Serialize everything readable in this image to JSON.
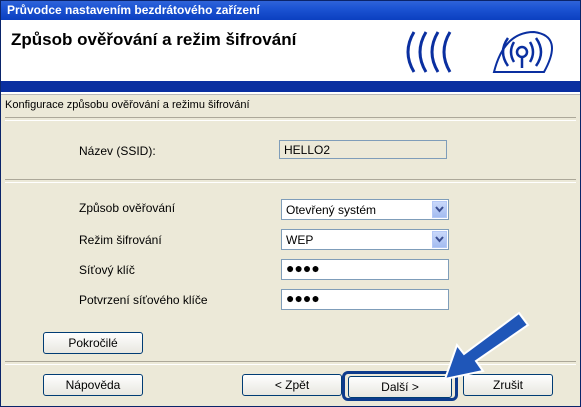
{
  "window": {
    "title": "Průvodce nastavením bezdrátového zařízení"
  },
  "header": {
    "title": "Způsob ověřování a režim šifrování",
    "logo_icon": "wireless-signal-icon"
  },
  "section": {
    "label": "Konfigurace způsobu ověřování a režimu šifrování"
  },
  "ssid": {
    "label": "Název (SSID):",
    "value": "HELLO2"
  },
  "auth": {
    "label": "Způsob ověřování",
    "value": "Otevřený systém"
  },
  "encryption": {
    "label": "Režim šifrování",
    "value": "WEP"
  },
  "network_key": {
    "label": "Síťový klíč",
    "value": "●●●●"
  },
  "confirm_key": {
    "label": "Potvrzení síťového klíče",
    "value": "●●●●"
  },
  "buttons": {
    "advanced": "Pokročilé",
    "help": "Nápověda",
    "back": "< Zpět",
    "next": "Další >",
    "cancel": "Zrušit"
  },
  "colors": {
    "titlebar": "#1d55d4",
    "header_band": "#0a2fa0",
    "arrow": "#1f56b8"
  }
}
